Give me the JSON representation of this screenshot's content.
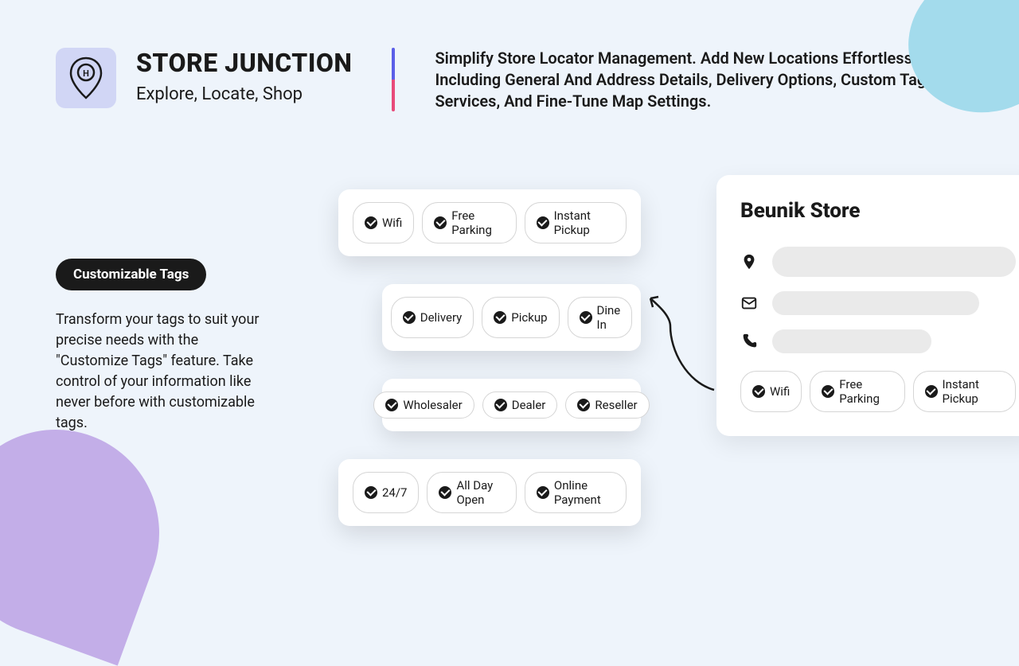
{
  "header": {
    "title": "STORE JUNCTION",
    "tagline": "Explore, Locate, Shop",
    "description": "Simplify Store Locator Management. Add New Locations Effortlessly, Including General And Address Details, Delivery Options, Custom Tags, Services, And Fine-Tune Map Settings."
  },
  "feature": {
    "badge": "Customizable Tags",
    "text": "Transform your tags to suit your precise needs with the \"Customize Tags\" feature. Take control of your information like never before with customizable tags."
  },
  "tag_rows": [
    [
      "Wifi",
      "Free Parking",
      "Instant Pickup"
    ],
    [
      "Delivery",
      "Pickup",
      "Dine In"
    ],
    [
      "Wholesaler",
      "Dealer",
      "Reseller"
    ],
    [
      "24/7",
      "All Day Open",
      "Online Payment"
    ]
  ],
  "store_card": {
    "title": "Beunik Store",
    "tags": [
      "Wifi",
      "Free Parking",
      "Instant Pickup"
    ]
  }
}
